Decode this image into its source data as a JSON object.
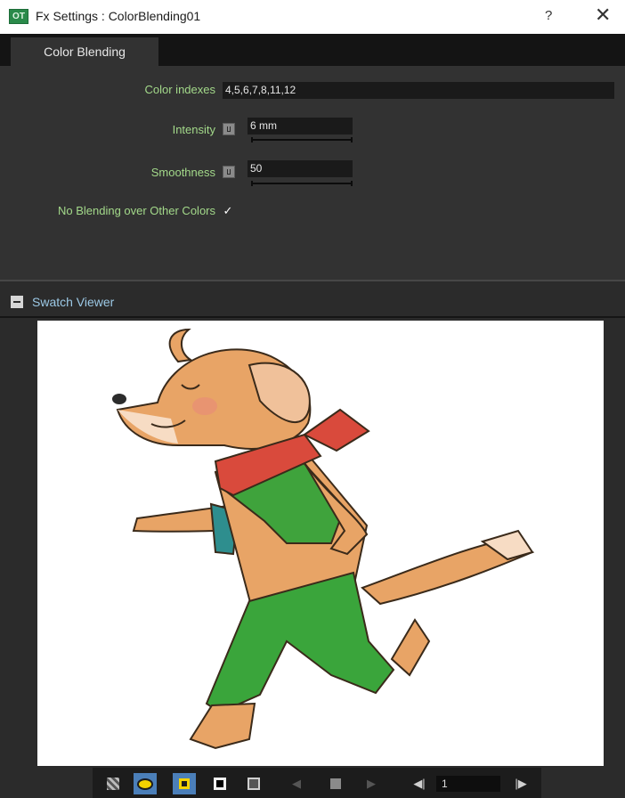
{
  "window": {
    "app_icon_text": "OT",
    "title": "Fx Settings : ColorBlending01",
    "help_label": "?",
    "close_label": "✕"
  },
  "tabs": [
    {
      "label": "Color Blending",
      "active": true
    }
  ],
  "settings": {
    "color_indexes": {
      "label": "Color indexes",
      "value": "4,5,6,7,8,11,12"
    },
    "intensity": {
      "label": "Intensity",
      "value": "6 mm"
    },
    "smoothness": {
      "label": "Smoothness",
      "value": "50"
    },
    "no_blending": {
      "label": "No Blending over Other Colors",
      "checked": true,
      "mark": "✓"
    }
  },
  "swatch_viewer": {
    "title": "Swatch Viewer",
    "collapse_icon": "minus-icon"
  },
  "toolbar": {
    "buttons": [
      {
        "name": "checkerboard-bg-button",
        "icon": "checkerboard-icon",
        "active": false
      },
      {
        "name": "preview-toggle-button",
        "icon": "eye-icon",
        "active": true
      },
      {
        "name": "camera-box-button",
        "icon": "square-yellow-icon",
        "active": true
      },
      {
        "name": "black-bg-button",
        "icon": "square-black-icon",
        "active": false
      },
      {
        "name": "white-bg-button",
        "icon": "square-outline-icon",
        "active": false
      }
    ],
    "frame_value": "1"
  },
  "colors": {
    "label_green": "#a3d98a",
    "section_blue": "#9cc9e6",
    "active_blue": "#4b7fb9",
    "fur": "#e8a466",
    "vest": "#3fa33c",
    "pants": "#3aa53b",
    "scarf": "#d94a3c",
    "shirt": "#2e8e8e"
  }
}
